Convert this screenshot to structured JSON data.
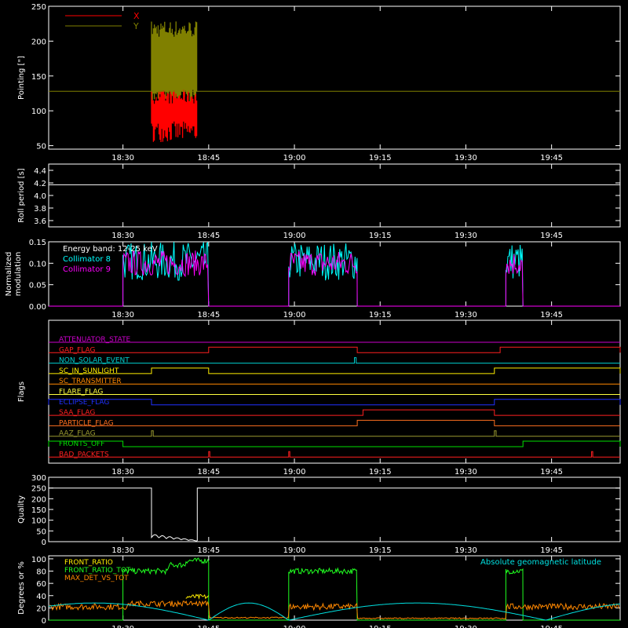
{
  "time_axis": {
    "x_range": [
      "18:17",
      "19:57"
    ],
    "ticks": [
      "18:30",
      "18:45",
      "19:00",
      "19:15",
      "19:30",
      "19:45"
    ]
  },
  "chart_data": [
    {
      "type": "line",
      "ylabel": "Pointing [\"]",
      "ylim": [
        45,
        250
      ],
      "y_ticks": [
        50,
        100,
        150,
        200,
        250
      ],
      "legend": "top-left",
      "series": [
        {
          "name": "X",
          "color": "#ff0000",
          "band": {
            "t_start": "18:35",
            "t_end": "18:43",
            "low": [
              55,
              85
            ],
            "high": [
              110,
              130
            ]
          }
        },
        {
          "name": "Y",
          "color": "#808000",
          "band": {
            "t_start": "18:35",
            "t_end": "18:43",
            "low": [
              110,
              130
            ],
            "high": [
              205,
              230
            ]
          }
        }
      ],
      "reference_line": {
        "y": 128,
        "color": "#808000"
      }
    },
    {
      "type": "line",
      "ylabel": "Roll period [s]",
      "ylim": [
        3.5,
        4.5
      ],
      "y_ticks": [
        "3.6",
        "3.8",
        "4.0",
        "4.2",
        "4.4"
      ],
      "series": [
        {
          "color": "#ffffff",
          "constant": 4.17
        }
      ]
    },
    {
      "type": "line",
      "ylabel": "Normalized modulation",
      "ylim": [
        0,
        0.15
      ],
      "y_ticks": [
        "0.00",
        "0.05",
        "0.10",
        "0.15"
      ],
      "annotation": "Energy band: 12-25 keV",
      "legend": "top-left",
      "segments": [
        [
          "18:30",
          "18:45"
        ],
        [
          "18:59",
          "19:11"
        ],
        [
          "19:37",
          "19:40"
        ]
      ],
      "series": [
        {
          "name": "Collimator 8",
          "color": "#00ffff",
          "level": 0.105,
          "spread": 0.045
        },
        {
          "name": "Collimator 9",
          "color": "#ff00ff",
          "level": 0.1,
          "spread": 0.03
        }
      ]
    },
    {
      "type": "line",
      "ylabel": "Flags",
      "flags": [
        {
          "name": "ATTENUATOR_STATE",
          "color": "#cc00cc",
          "on": []
        },
        {
          "name": "GAP_FLAG",
          "color": "#ff2020",
          "on": [
            [
              "18:45",
              "19:11"
            ],
            [
              "19:36",
              "19:57"
            ]
          ]
        },
        {
          "name": "NON_SOLAR_EVENT",
          "color": "#00d0d0",
          "on": [
            [
              "19:10.5",
              "19:10.8"
            ]
          ]
        },
        {
          "name": "SC_IN_SUNLIGHT",
          "color": "#ffee00",
          "on": [
            [
              "18:35",
              "18:45"
            ],
            [
              "19:35",
              "19:57"
            ]
          ]
        },
        {
          "name": "SC_TRANSMITTER",
          "color": "#ff8800",
          "on": []
        },
        {
          "name": "FLARE_FLAG",
          "color": "#ffff40",
          "on": []
        },
        {
          "name": "ECLIPSE_FLAG",
          "color": "#2030ff",
          "on": [
            [
              "18:17",
              "18:35"
            ],
            [
              "19:35",
              "19:57"
            ]
          ]
        },
        {
          "name": "SAA_FLAG",
          "color": "#ff2020",
          "on": [
            [
              "19:12",
              "19:35"
            ]
          ]
        },
        {
          "name": "PARTICLE_FLAG",
          "color": "#ff7020",
          "on": [
            [
              "19:11",
              "19:35"
            ]
          ]
        },
        {
          "name": "AAZ_FLAG",
          "color": "#9a9a30",
          "on": [
            [
              "18:35",
              "18:35.3"
            ],
            [
              "19:35",
              "19:35.3"
            ]
          ]
        },
        {
          "name": "FRONTS_OFF",
          "color": "#00e000",
          "on": [
            [
              "18:17",
              "18:30"
            ],
            [
              "19:40",
              "19:57"
            ]
          ]
        },
        {
          "name": "BAD_PACKETS",
          "color": "#ff2020",
          "on": [
            [
              "18:45",
              "18:45.2"
            ],
            [
              "18:59",
              "18:59.2"
            ],
            [
              "19:52",
              "19:52.2"
            ]
          ]
        }
      ]
    },
    {
      "type": "line",
      "ylabel": "Quality",
      "ylim": [
        0,
        300
      ],
      "y_ticks": [
        0,
        50,
        100,
        150,
        200,
        250,
        300
      ],
      "series": [
        {
          "color": "#ffffff",
          "steps": [
            [
              "18:17",
              250
            ],
            [
              "18:35",
              250
            ],
            [
              "18:35",
              30
            ],
            [
              "18:43",
              5
            ],
            [
              "18:43",
              250
            ],
            [
              "19:57",
              250
            ]
          ]
        }
      ]
    },
    {
      "type": "line",
      "ylabel": "Degrees or %",
      "ylim": [
        0,
        105
      ],
      "y_ticks": [
        0,
        20,
        40,
        60,
        80,
        100
      ],
      "legend": "top-left",
      "annotation_right": "Absolute geomagnetic latitude",
      "series": [
        {
          "name": "FRONT_RATIO",
          "color": "#ffee00"
        },
        {
          "name": "FRONT_RATIO_TOT",
          "color": "#20ff20"
        },
        {
          "name": "MAX_DET_VS_TOT",
          "color": "#ff8800"
        },
        {
          "name": "Absolute geomagnetic latitude",
          "color": "#00e0e0"
        }
      ]
    }
  ]
}
